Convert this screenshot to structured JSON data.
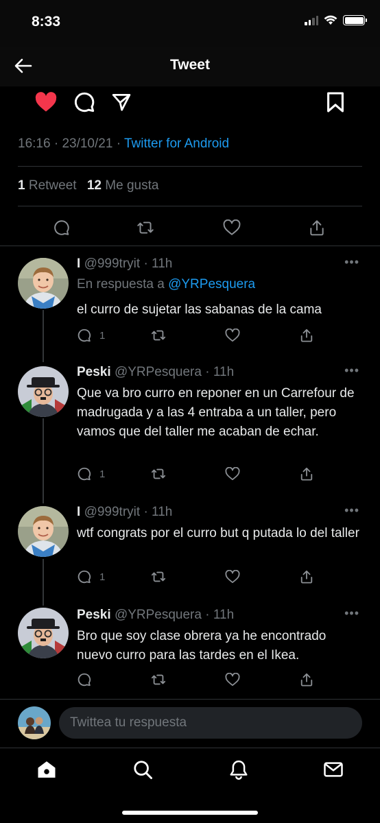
{
  "status_bar": {
    "time": "8:33"
  },
  "header": {
    "title": "Tweet"
  },
  "tweet": {
    "time": "16:16",
    "date": "23/10/21",
    "separator": "·",
    "source": "Twitter for Android",
    "retweets_count": "1",
    "retweets_label": "Retweet",
    "likes_count": "12",
    "likes_label": "Me gusta",
    "liked": true,
    "like_color": "#f91880"
  },
  "replies": [
    {
      "name": "I",
      "handle": "@999tryit",
      "time": "· 11h",
      "replying_prefix": "En respuesta a",
      "replying_to": "@YRPesquera",
      "text": "el curro de sujetar las sabanas de la cama",
      "reply_count": "1",
      "avatar_icon": "child-avatar"
    },
    {
      "name": "Peski",
      "handle": "@YRPesquera",
      "time": "· 11h",
      "text": "Que va bro curro en reponer en un Carrefour de madrugada y a las 4 entraba a un taller, pero vamos que del taller me acaban de echar.",
      "reply_count": "1",
      "avatar_icon": "man-with-hat-avatar"
    },
    {
      "name": "I",
      "handle": "@999tryit",
      "time": "· 11h",
      "text": "wtf congrats por el curro but q putada lo del taller",
      "reply_count": "1",
      "avatar_icon": "child-avatar"
    },
    {
      "name": "Peski",
      "handle": "@YRPesquera",
      "time": "· 11h",
      "text": "Bro que soy clase obrera ya he encontrado nuevo curro para las tardes en el Ikea.",
      "reply_count": "",
      "avatar_icon": "man-with-hat-avatar"
    }
  ],
  "more_glyph": "•••",
  "compose": {
    "placeholder": "Twittea tu respuesta"
  },
  "tabs": [
    "home-icon",
    "search-icon",
    "notifications-icon",
    "messages-icon"
  ],
  "colors": {
    "accent": "#1d9bf0",
    "background": "#000000",
    "muted": "#71767b",
    "like": "#f91880"
  }
}
